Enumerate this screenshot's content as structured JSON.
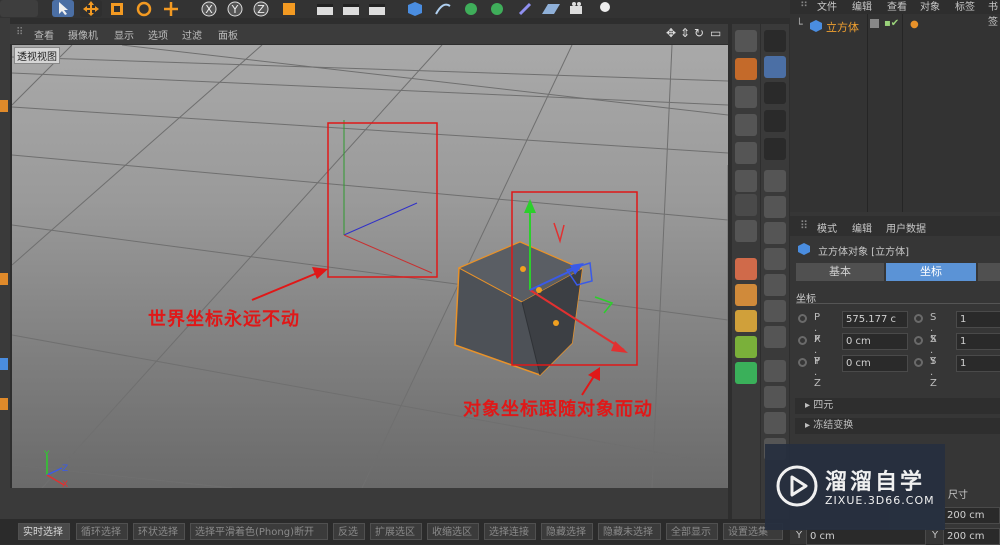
{
  "viewport": {
    "menu": [
      "查看",
      "摄像机",
      "显示",
      "选项",
      "过滤",
      "面板"
    ],
    "label": "透视视图"
  },
  "annotations": {
    "world": "世界坐标永远不动",
    "object": "对象坐标跟随对象而动"
  },
  "status_bar": {
    "items": [
      "实时选择",
      "循环选择",
      "环状选择",
      "选择平滑着色(Phong)断开",
      "反选",
      "扩展选区",
      "收缩选区",
      "选择连接",
      "隐藏选择",
      "隐藏未选择",
      "全部显示",
      "设置选集"
    ]
  },
  "object_manager": {
    "menu": [
      "文件",
      "编辑",
      "查看",
      "对象",
      "标签",
      "书签"
    ],
    "object_name": "立方体"
  },
  "attribute_manager": {
    "menu": [
      "模式",
      "编辑",
      "用户数据"
    ],
    "object_title": "立方体对象 [立方体]",
    "tabs": [
      "基本",
      "坐标"
    ],
    "active_tab": "坐标",
    "section": "坐标",
    "rows": [
      {
        "label": "P . X",
        "value": "575.177 c",
        "label2": "S . X",
        "value2": "1"
      },
      {
        "label": "P . Y",
        "value": "0 cm",
        "label2": "S . Y",
        "value2": "1"
      },
      {
        "label": "P . Z",
        "value": "0 cm",
        "label2": "S . Z",
        "value2": "1"
      }
    ],
    "collapsed": [
      "四元",
      "冻结变换"
    ],
    "bottom_label": "尺寸",
    "bottom_row": {
      "y_label": "Y",
      "y_value": "0 cm",
      "y2_label": "Y",
      "y2_value": "200 cm",
      "v1": "200 cm"
    }
  },
  "watermark": {
    "title": "溜溜自学",
    "url": "ZIXUE.3D66.COM"
  },
  "colors": {
    "accent_active_tab": "#5b93d6",
    "annotation_red": "#e01818",
    "cube_fill": "#4d5157",
    "selection_orange": "#e8922a"
  },
  "axis_labels": {
    "x": "X",
    "y": "Y",
    "z": "Z"
  }
}
